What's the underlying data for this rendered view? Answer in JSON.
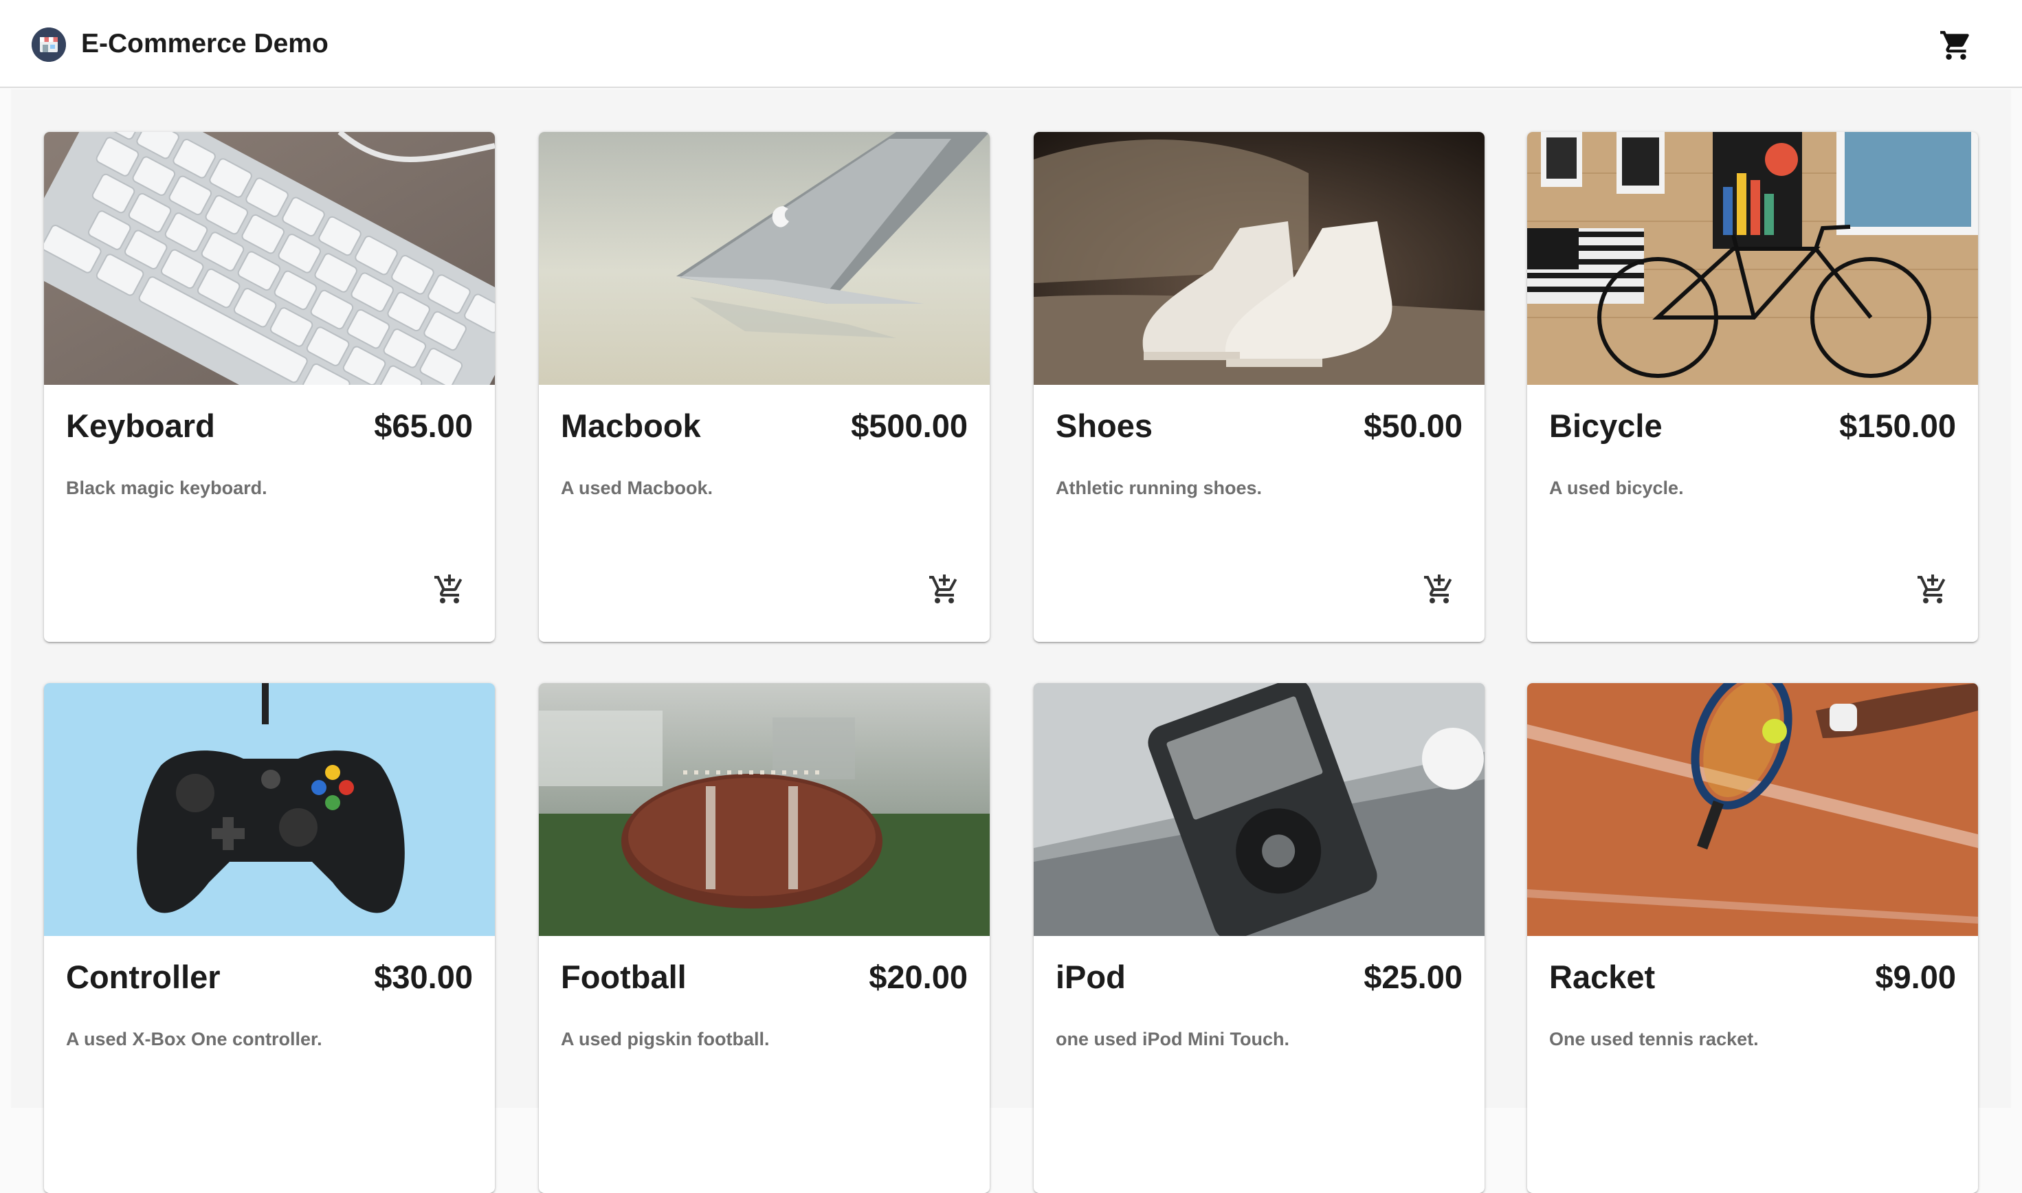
{
  "app": {
    "title": "E-Commerce Demo",
    "logo_icon": "storefront-icon",
    "cart_icon": "shopping-cart-icon"
  },
  "colors": {
    "appbar_background": "#ffffff",
    "page_background": "#f5f5f5",
    "card_background": "#ffffff",
    "primary_text": "#1b1b1b",
    "secondary_text": "#6e6e6e",
    "icon": "#212121"
  },
  "products": [
    {
      "name": "Keyboard",
      "price": "$65.00",
      "description": "Black magic keyboard.",
      "image_icon": "keyboard-photo",
      "add_icon": "add-shopping-cart-icon"
    },
    {
      "name": "Macbook",
      "price": "$500.00",
      "description": "A used Macbook.",
      "image_icon": "laptop-photo",
      "add_icon": "add-shopping-cart-icon"
    },
    {
      "name": "Shoes",
      "price": "$50.00",
      "description": "Athletic running shoes.",
      "image_icon": "sneakers-photo",
      "add_icon": "add-shopping-cart-icon"
    },
    {
      "name": "Bicycle",
      "price": "$150.00",
      "description": "A used bicycle.",
      "image_icon": "bicycle-photo",
      "add_icon": "add-shopping-cart-icon"
    },
    {
      "name": "Controller",
      "price": "$30.00",
      "description": "A used X-Box One controller.",
      "image_icon": "game-controller-photo",
      "add_icon": "add-shopping-cart-icon"
    },
    {
      "name": "Football",
      "price": "$20.00",
      "description": "A used pigskin football.",
      "image_icon": "football-photo",
      "add_icon": "add-shopping-cart-icon"
    },
    {
      "name": "iPod",
      "price": "$25.00",
      "description": "one used iPod Mini Touch.",
      "image_icon": "ipod-photo",
      "add_icon": "add-shopping-cart-icon"
    },
    {
      "name": "Racket",
      "price": "$9.00",
      "description": "One used tennis racket.",
      "image_icon": "tennis-racket-photo",
      "add_icon": "add-shopping-cart-icon"
    }
  ]
}
